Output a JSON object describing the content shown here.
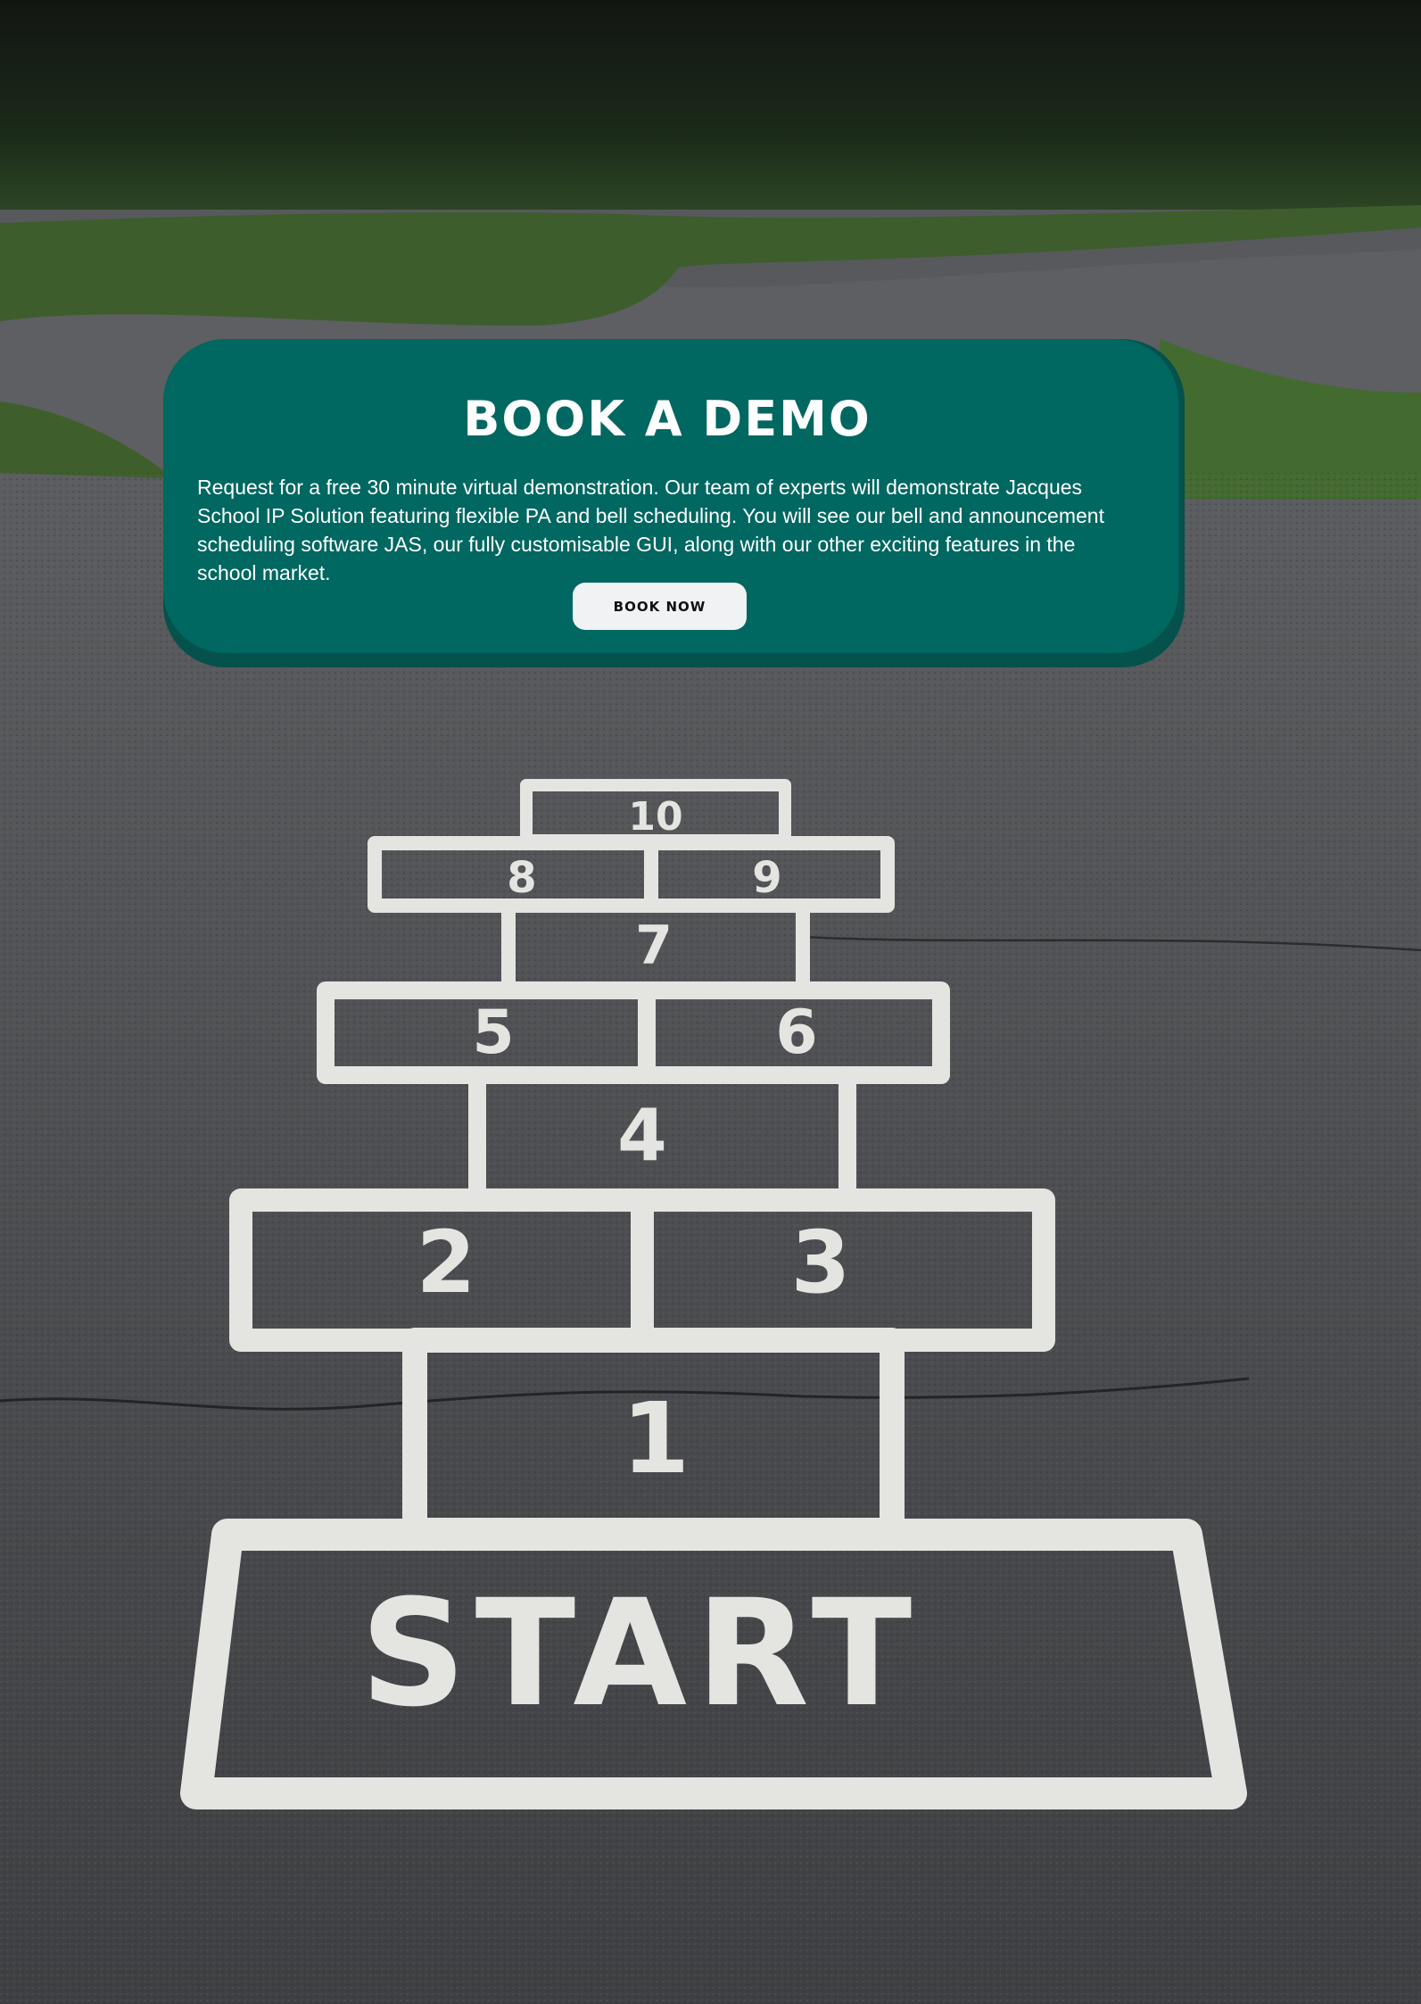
{
  "demo_card": {
    "title": "BOOK A DEMO",
    "description": "Request for a free 30 minute virtual demonstration. Our team of experts will demonstrate Jacques School IP Solution featuring flexible PA and bell scheduling. You will see our bell and announcement scheduling software JAS, our fully customisable GUI, along with our other exciting features in the school market.",
    "button_label": "BOOK NOW"
  },
  "background": {
    "hopscotch_labels": [
      "10",
      "8",
      "9",
      "7",
      "5",
      "6",
      "4",
      "2",
      "3",
      "1",
      "START"
    ]
  },
  "colors": {
    "card": "#006761",
    "card_shadow": "#05514c",
    "button": "#f1f2f3",
    "asphalt": "#4a4c4f",
    "chalk": "#e4e4e1"
  }
}
